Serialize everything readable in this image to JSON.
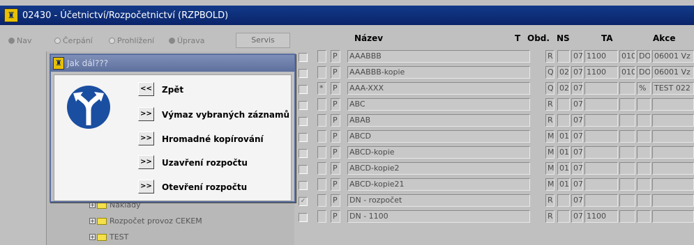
{
  "window": {
    "title": "02430 - Účetnictví/Rozpočetnictví (RZPBOLD)",
    "icon": "building-icon"
  },
  "modes": {
    "nav": "Nav",
    "cerpani": "Čerpání",
    "prohlizeni": "Prohlížení",
    "uprava": "Úprava",
    "servis": "Servis"
  },
  "tree": {
    "items": [
      {
        "label": "Náklady"
      },
      {
        "label": "Rozpočet provoz CEKEM"
      },
      {
        "label": "TEST"
      }
    ]
  },
  "table": {
    "headers": {
      "nazev": "Název",
      "t": "T",
      "obd": "Obd.",
      "ns": "NS",
      "ta": "TA",
      "akce": "Akce"
    },
    "rows": [
      {
        "flag": "",
        "p": "P",
        "nazev": "AAABBB",
        "t": "R",
        "obd": "",
        "y": "07",
        "ns": "1100",
        "ta": "010",
        "x": "DO MŠ",
        "akce": "06001 Vz"
      },
      {
        "flag": "",
        "p": "P",
        "nazev": "AAABBB-kopie",
        "t": "Q",
        "obd": "02",
        "y": "07",
        "ns": "1100",
        "ta": "010",
        "x": "DO MŠ",
        "akce": "06001 Vz"
      },
      {
        "flag": "*",
        "p": "P",
        "nazev": "AAA-XXX",
        "t": "Q",
        "obd": "02",
        "y": "07",
        "ns": "",
        "ta": "",
        "x": "%",
        "akce": "TEST 022"
      },
      {
        "flag": "",
        "p": "P",
        "nazev": "ABC",
        "t": "R",
        "obd": "",
        "y": "07",
        "ns": "",
        "ta": "",
        "x": "",
        "akce": ""
      },
      {
        "flag": "",
        "p": "P",
        "nazev": "  ABAB",
        "t": "R",
        "obd": "",
        "y": "07",
        "ns": "",
        "ta": "",
        "x": "",
        "akce": ""
      },
      {
        "flag": "",
        "p": "P",
        "nazev": "  ABCD",
        "t": "M",
        "obd": "01",
        "y": "07",
        "ns": "",
        "ta": "",
        "x": "",
        "akce": ""
      },
      {
        "flag": "",
        "p": "P",
        "nazev": "  ABCD-kopie",
        "t": "M",
        "obd": "01",
        "y": "07",
        "ns": "",
        "ta": "",
        "x": "",
        "akce": ""
      },
      {
        "flag": "",
        "p": "P",
        "nazev": "ABCD-kopie2",
        "t": "M",
        "obd": "01",
        "y": "07",
        "ns": "",
        "ta": "",
        "x": "",
        "akce": ""
      },
      {
        "flag": "",
        "p": "P",
        "nazev": "  ABCD-kopie21",
        "t": "M",
        "obd": "01",
        "y": "07",
        "ns": "",
        "ta": "",
        "x": "",
        "akce": ""
      },
      {
        "flag": "",
        "p": "P",
        "nazev": "DN - rozpočet",
        "t": "R",
        "obd": "",
        "y": "07",
        "ns": "",
        "ta": "",
        "x": "",
        "akce": ""
      },
      {
        "flag": "",
        "p": "P",
        "nazev": "  DN - 1100",
        "t": "R",
        "obd": "",
        "y": "07",
        "ns": "1100",
        "ta": "",
        "x": "",
        "akce": ""
      }
    ]
  },
  "dialog": {
    "title": "Jak dál???",
    "icon": "fork-arrows-icon",
    "actions": [
      {
        "btn": "<<",
        "label": "Zpět"
      },
      {
        "btn": ">>",
        "label": "Výmaz vybraných záznamů"
      },
      {
        "btn": ">>",
        "label": "Hromadné kopírování"
      },
      {
        "btn": ">>",
        "label": "Uzavření rozpočtu"
      },
      {
        "btn": ">>",
        "label": "Otevření rozpočtu"
      }
    ]
  },
  "colors": {
    "titlebar": "#0a246a",
    "dialog_title": "#5d6f9c",
    "sign": "#1a4ea0"
  }
}
